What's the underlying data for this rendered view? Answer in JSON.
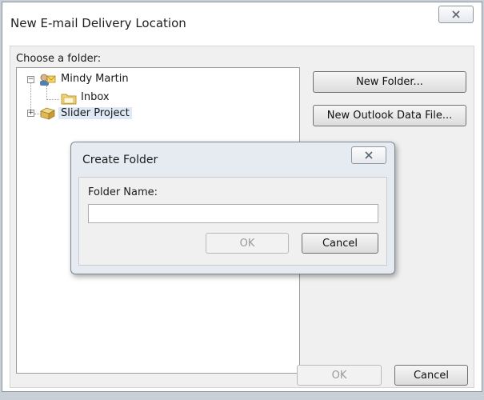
{
  "window": {
    "title": "New E-mail Delivery Location",
    "close_icon": "close-icon"
  },
  "folder_picker": {
    "label": "Choose a folder:",
    "tree": [
      {
        "label": "Mindy Martin",
        "icon": "mailbox-account-icon",
        "expanded": true,
        "selected": false
      },
      {
        "label": "Inbox",
        "icon": "inbox-folder-icon",
        "selected": false
      },
      {
        "label": "Slider Project",
        "icon": "data-file-icon",
        "expanded": false,
        "selected": true
      }
    ]
  },
  "buttons": {
    "new_folder": "New Folder...",
    "new_data_file": "New Outlook Data File...",
    "ok": "OK",
    "cancel": "Cancel"
  },
  "create_folder_dialog": {
    "title": "Create Folder",
    "field_label": "Folder Name:",
    "field_value": "",
    "ok": "OK",
    "cancel": "Cancel"
  },
  "colors": {
    "selection": "#dfe9f5",
    "disabled_text": "#9a9a9a"
  }
}
